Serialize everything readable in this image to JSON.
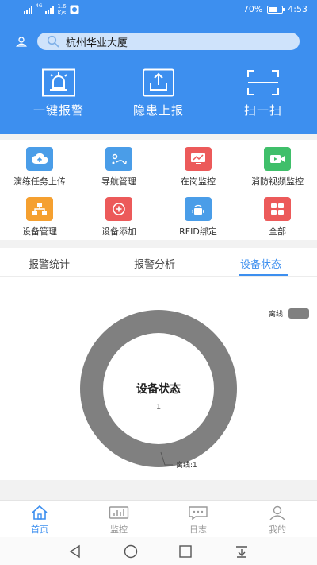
{
  "status_bar": {
    "network_type": "4G",
    "net_speed_value": "1.6",
    "net_speed_unit": "K/s",
    "battery_percent": "70%",
    "time": "4:53"
  },
  "header": {
    "search": {
      "value": "杭州华业大厦",
      "placeholder": "杭州华业大厦"
    },
    "actions": [
      {
        "label": "一键报警",
        "icon": "alarm-siren-icon"
      },
      {
        "label": "隐患上报",
        "icon": "upload-report-icon"
      },
      {
        "label": "扫一扫",
        "icon": "scan-icon"
      }
    ]
  },
  "menu": {
    "items": [
      {
        "label": "演练任务上传",
        "icon": "cloud-upload-icon",
        "color": "#4a9de8"
      },
      {
        "label": "导航管理",
        "icon": "navigation-icon",
        "color": "#4a9de8"
      },
      {
        "label": "在岗监控",
        "icon": "monitor-icon",
        "color": "#ec5a5a"
      },
      {
        "label": "消防视频监控",
        "icon": "video-camera-icon",
        "color": "#3fbf6a"
      },
      {
        "label": "设备管理",
        "icon": "org-chart-icon",
        "color": "#f5a030"
      },
      {
        "label": "设备添加",
        "icon": "add-icon",
        "color": "#ec5a5a"
      },
      {
        "label": "RFID绑定",
        "icon": "rfid-icon",
        "color": "#4a9de8"
      },
      {
        "label": "全部",
        "icon": "grid-icon",
        "color": "#ec5a5a"
      }
    ]
  },
  "stats": {
    "tabs": [
      {
        "label": "报警统计",
        "active": false
      },
      {
        "label": "报警分析",
        "active": false
      },
      {
        "label": "设备状态",
        "active": true
      }
    ],
    "legend_label": "离线",
    "legend_color": "#808080",
    "center_title": "设备状态",
    "center_total": "1",
    "callout_label": "离线:1"
  },
  "chart_data": {
    "type": "pie",
    "categories": [
      "离线"
    ],
    "values": [
      1
    ],
    "colors": [
      "#808080"
    ],
    "title": "设备状态",
    "total": 1,
    "legend_position": "top-right"
  },
  "bottom_nav": {
    "items": [
      {
        "label": "首页",
        "icon": "home-icon",
        "active": true
      },
      {
        "label": "监控",
        "icon": "monitor-chart-icon",
        "active": false
      },
      {
        "label": "日志",
        "icon": "log-icon",
        "active": false
      },
      {
        "label": "我的",
        "icon": "user-icon",
        "active": false
      }
    ]
  },
  "colors": {
    "primary": "#3d8fef",
    "offline": "#808080"
  }
}
